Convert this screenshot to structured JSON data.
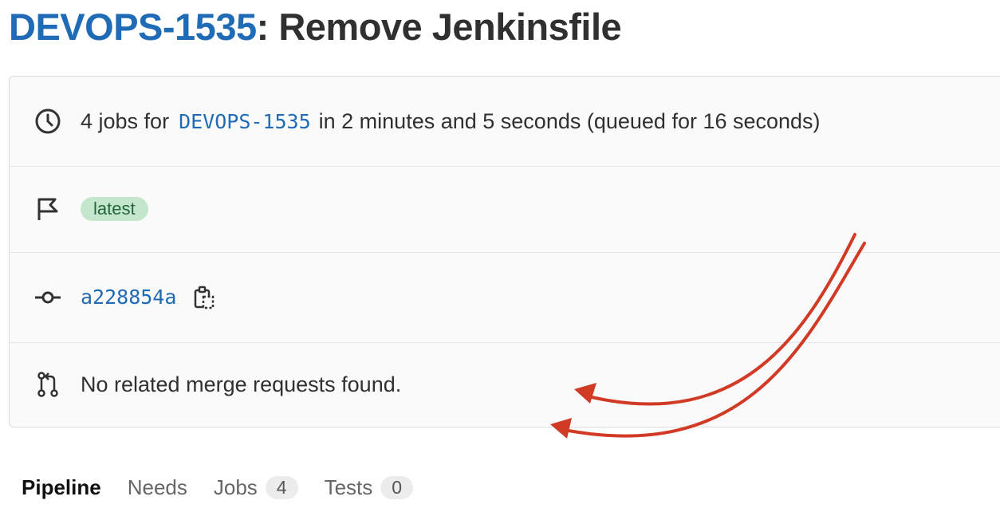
{
  "header": {
    "issue_ref": "DEVOPS-1535",
    "title_rest": ": Remove Jenkinsfile"
  },
  "info": {
    "jobs_count_text": "4 jobs for",
    "branch": "DEVOPS-1535",
    "duration_text": "in 2 minutes and 5 seconds (queued for 16 seconds)",
    "badge": "latest",
    "commit_sha": "a228854a",
    "merge_requests_text": "No related merge requests found."
  },
  "tabs": [
    {
      "label": "Pipeline",
      "count": null
    },
    {
      "label": "Needs",
      "count": null
    },
    {
      "label": "Jobs",
      "count": "4"
    },
    {
      "label": "Tests",
      "count": "0"
    }
  ],
  "colors": {
    "link": "#1f6bb5",
    "badge_bg": "#c3e6cd",
    "badge_text": "#24663b",
    "annotation_arrow": "#d13a24"
  },
  "icons": [
    "clock-icon",
    "flag-icon",
    "commit-icon",
    "copy-icon",
    "merge-request-icon"
  ]
}
